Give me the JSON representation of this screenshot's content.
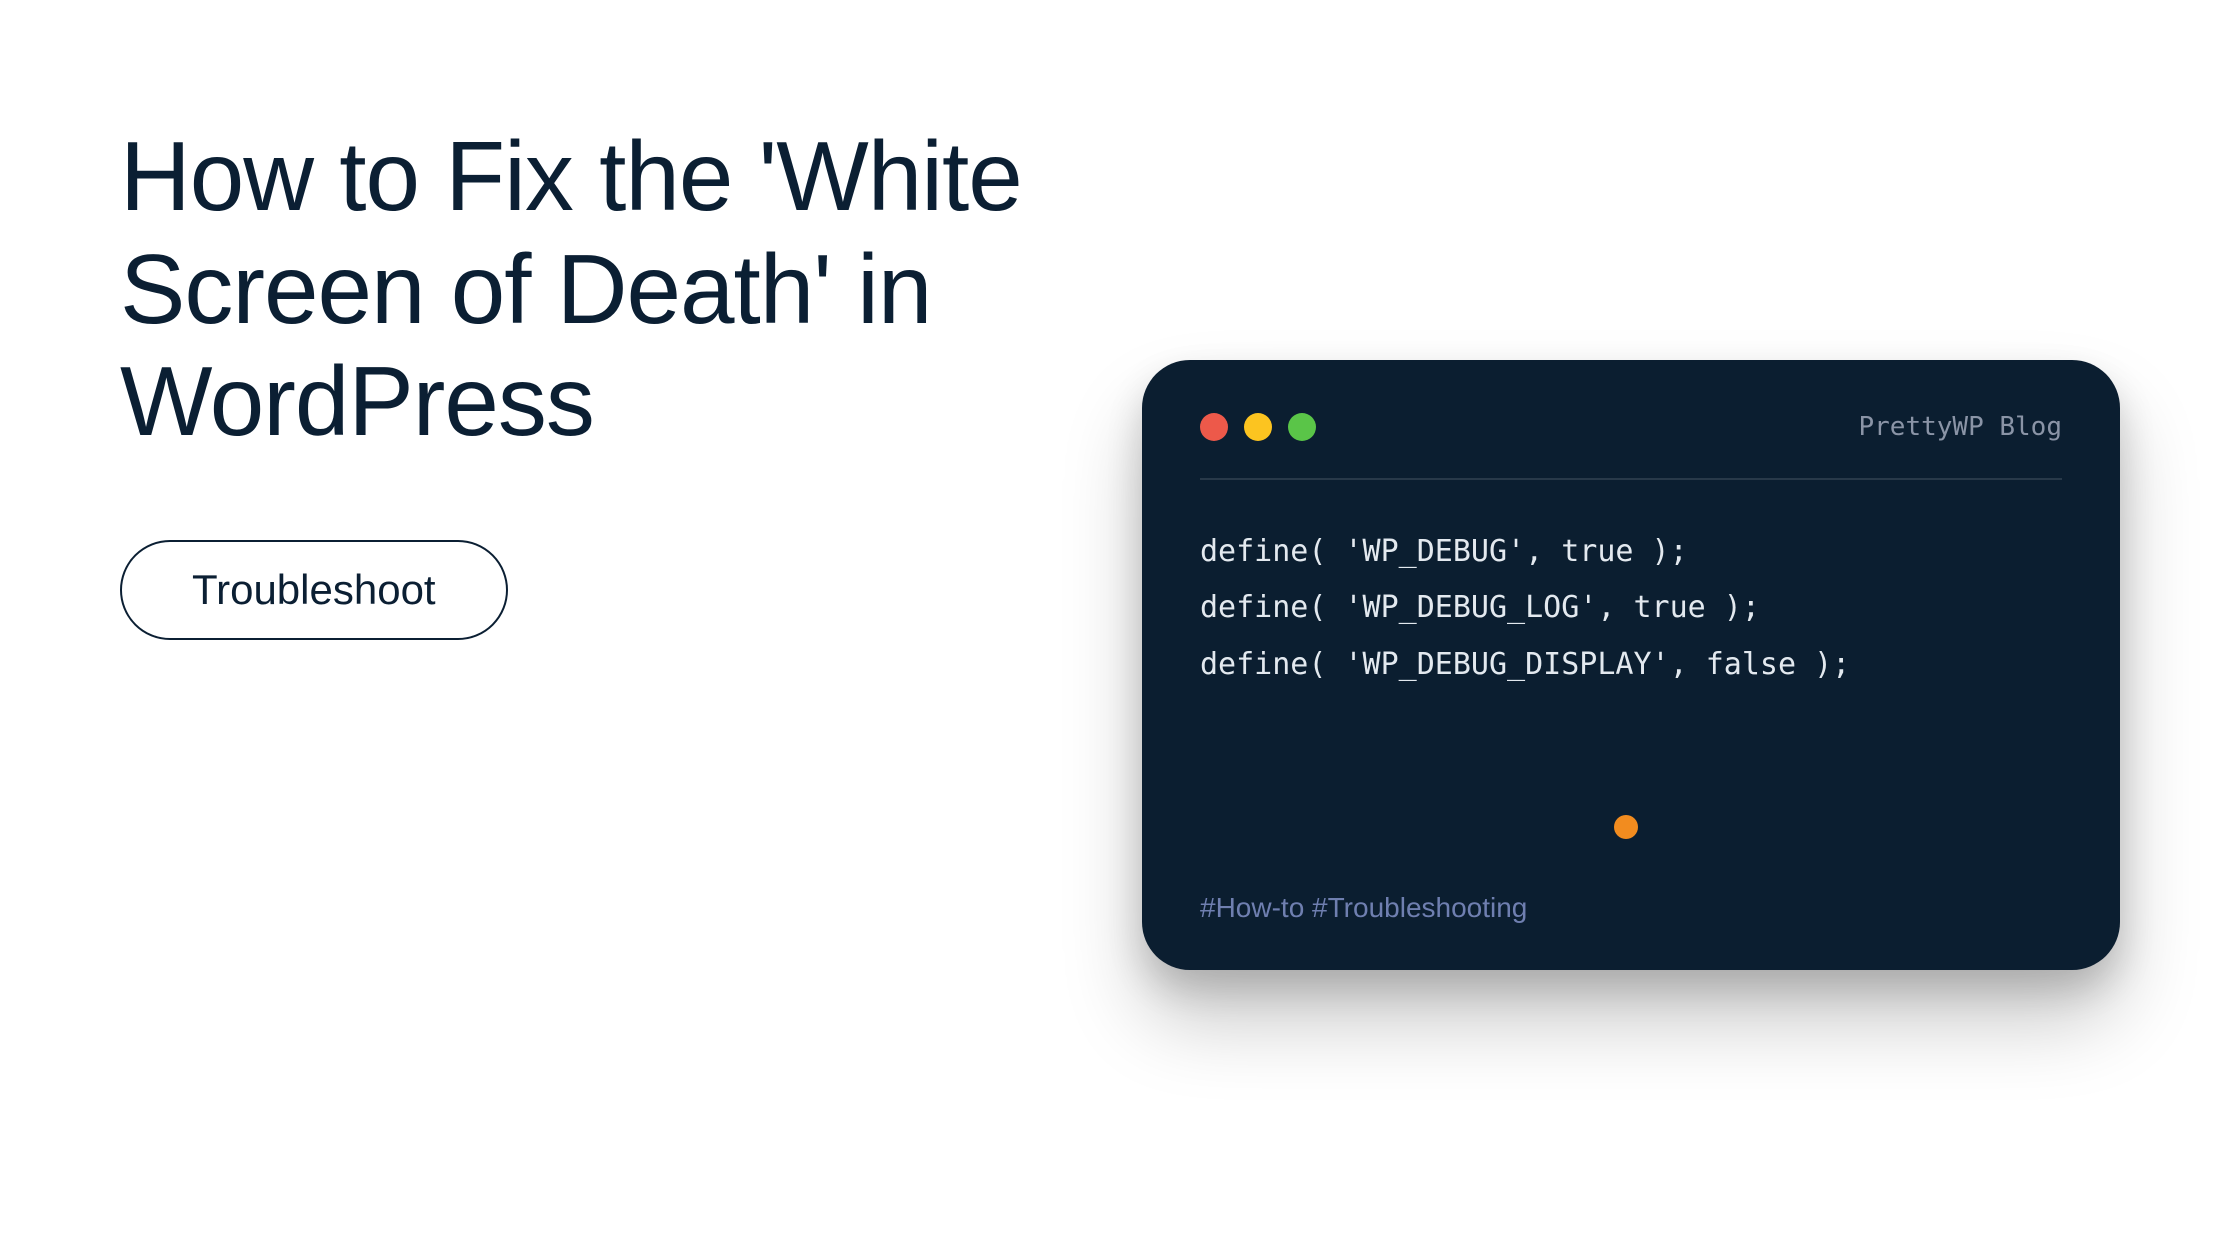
{
  "title": "How to Fix the 'White Screen of Death' in WordPress",
  "button": {
    "label": "Troubleshoot"
  },
  "terminal": {
    "brand": "PrettyWP Blog",
    "code": "define( 'WP_DEBUG', true );\ndefine( 'WP_DEBUG_LOG', true );\ndefine( 'WP_DEBUG_DISPLAY', false );",
    "tags": "#How-to #Troubleshooting"
  }
}
